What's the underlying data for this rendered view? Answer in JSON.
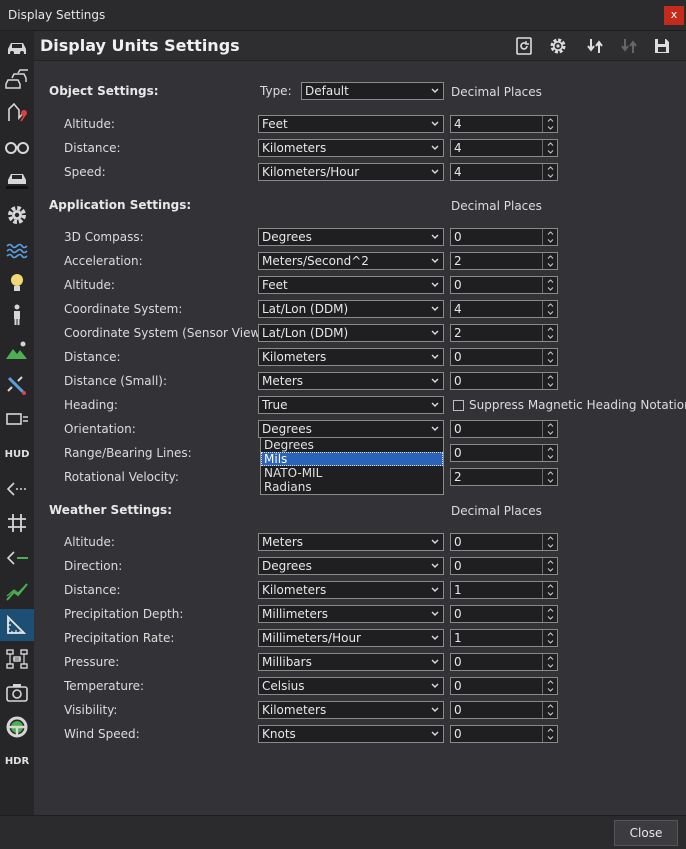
{
  "window": {
    "title": "Display Settings",
    "close_glyph": "x"
  },
  "header": {
    "title": "Display Units Settings"
  },
  "header_icons": [
    "reset-icon",
    "gear-icon",
    "import-icon",
    "export-icon",
    "save-icon"
  ],
  "sidebar": {
    "items": [
      {
        "icon": "car-icon"
      },
      {
        "icon": "vehicles-icon"
      },
      {
        "icon": "route-icon"
      },
      {
        "icon": "binoculars-icon"
      },
      {
        "icon": "car-shadow-icon"
      },
      {
        "icon": "gear-icon"
      },
      {
        "icon": "water-icon"
      },
      {
        "icon": "lightbulb-icon"
      },
      {
        "icon": "person-icon"
      },
      {
        "icon": "terrain-icon"
      },
      {
        "icon": "satellite-icon"
      },
      {
        "icon": "window-list-icon"
      },
      {
        "icon": "hud-icon",
        "text": "HUD"
      },
      {
        "icon": "lines-left-icon"
      },
      {
        "icon": "grid-icon"
      },
      {
        "icon": "line-arrow-icon"
      },
      {
        "icon": "graph-icon"
      },
      {
        "icon": "ruler-icon",
        "active": true
      },
      {
        "icon": "network-icon"
      },
      {
        "icon": "camera-settings-icon"
      },
      {
        "icon": "steering-icon"
      },
      {
        "icon": "hdr-icon",
        "text": "HDR"
      }
    ]
  },
  "object": {
    "title": "Object Settings:",
    "type_label": "Type:",
    "type_value": "Default",
    "decimal_label": "Decimal Places",
    "rows": [
      {
        "label": "Altitude:",
        "unit": "Feet",
        "decimals": "4"
      },
      {
        "label": "Distance:",
        "unit": "Kilometers",
        "decimals": "4"
      },
      {
        "label": "Speed:",
        "unit": "Kilometers/Hour",
        "decimals": "4"
      }
    ]
  },
  "application": {
    "title": "Application Settings:",
    "decimal_label": "Decimal Places",
    "rows": [
      {
        "label": "3D Compass:",
        "unit": "Degrees",
        "decimals": "0"
      },
      {
        "label": "Acceleration:",
        "unit": "Meters/Second^2",
        "decimals": "2"
      },
      {
        "label": "Altitude:",
        "unit": "Feet",
        "decimals": "0"
      },
      {
        "label": "Coordinate System:",
        "unit": "Lat/Lon (DDM)",
        "decimals": "4"
      },
      {
        "label": "Coordinate System (Sensor View):",
        "unit": "Lat/Lon (DDM)",
        "decimals": "2"
      },
      {
        "label": "Distance:",
        "unit": "Kilometers",
        "decimals": "0"
      },
      {
        "label": "Distance (Small):",
        "unit": "Meters",
        "decimals": "0"
      },
      {
        "label": "Heading:",
        "unit": "True",
        "decimals": ""
      },
      {
        "label": "Orientation:",
        "unit": "Degrees",
        "decimals": "0"
      },
      {
        "label": "Range/Bearing Lines:",
        "unit": "",
        "decimals": "0"
      },
      {
        "label": "Rotational Velocity:",
        "unit": "",
        "decimals": "2"
      }
    ],
    "suppress_label": "Suppress Magnetic Heading Notation",
    "orientation_options": [
      "Degrees",
      "Mils",
      "NATO-MIL",
      "Radians"
    ],
    "orientation_highlighted": "Mils"
  },
  "weather": {
    "title": "Weather Settings:",
    "decimal_label": "Decimal Places",
    "rows": [
      {
        "label": "Altitude:",
        "unit": "Meters",
        "decimals": "0"
      },
      {
        "label": "Direction:",
        "unit": "Degrees",
        "decimals": "0"
      },
      {
        "label": "Distance:",
        "unit": "Kilometers",
        "decimals": "1"
      },
      {
        "label": "Precipitation Depth:",
        "unit": "Millimeters",
        "decimals": "0"
      },
      {
        "label": "Precipitation Rate:",
        "unit": "Millimeters/Hour",
        "decimals": "1"
      },
      {
        "label": "Pressure:",
        "unit": "Millibars",
        "decimals": "0"
      },
      {
        "label": "Temperature:",
        "unit": "Celsius",
        "decimals": "0"
      },
      {
        "label": "Visibility:",
        "unit": "Kilometers",
        "decimals": "0"
      },
      {
        "label": "Wind Speed:",
        "unit": "Knots",
        "decimals": "0"
      }
    ]
  },
  "footer": {
    "close_label": "Close"
  }
}
